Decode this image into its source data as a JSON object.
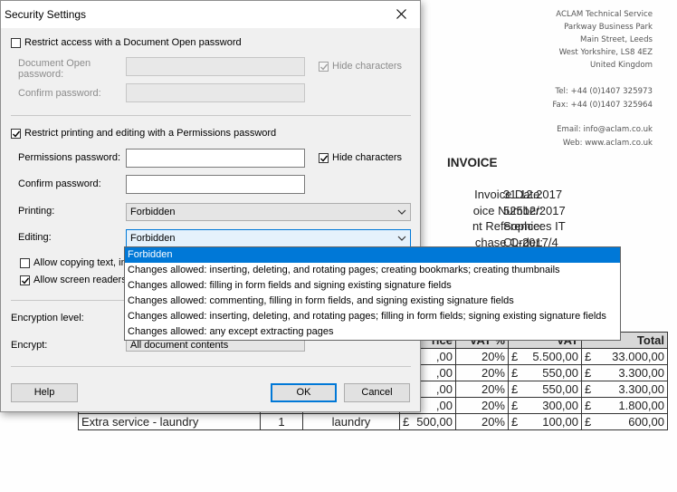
{
  "dialog": {
    "title": "Security Settings",
    "open_password": {
      "checkbox_label": "Restrict access with a Document Open password",
      "checked": false,
      "doc_open_label_line1": "Document Open",
      "doc_open_label_line2": "password:",
      "confirm_label": "Confirm password:",
      "hide_label": "Hide characters",
      "hide_checked": true
    },
    "permissions": {
      "checkbox_label": "Restrict printing and editing with a Permissions password",
      "checked": true,
      "password_label": "Permissions password:",
      "confirm_label": "Confirm password:",
      "hide_label": "Hide characters",
      "hide_checked": true,
      "printing_label": "Printing:",
      "printing_value": "Forbidden",
      "editing_label": "Editing:",
      "editing_value": "Forbidden",
      "allow_copy_label": "Allow copying text, im",
      "allow_copy_checked": false,
      "allow_screen_label": "Allow screen readers",
      "allow_screen_checked": true
    },
    "encryption": {
      "level_label": "Encryption level:",
      "encrypt_label": "Encrypt:",
      "encrypt_value": "All document contents"
    },
    "buttons": {
      "help": "Help",
      "ok": "OK",
      "cancel": "Cancel"
    },
    "editing_options": [
      "Forbidden",
      "Changes allowed: inserting, deleting, and rotating pages; creating bookmarks; creating thumbnails",
      "Changes allowed: filling in form fields and signing existing signature fields",
      "Changes allowed: commenting, filling in form fields, and signing existing signature fields",
      "Changes allowed: inserting, deleting, and rotating pages; filling in form fields; signing existing signature fields",
      "Changes allowed: any except extracting pages"
    ],
    "editing_selected_index": 0
  },
  "invoice": {
    "company_lines": [
      "ACLAM Technical Service",
      "Parkway Business Park",
      "Main Street, Leeds",
      "West Yorkshire, LS8 4EZ",
      "United Kingdom"
    ],
    "tel": "Tel: +44 (0)1407 325973",
    "fax": "Fax: +44 (0)1407 325964",
    "email": "Email: info@aclam.co.uk",
    "web": "Web: www.aclam.co.uk",
    "title": "INVOICE",
    "meta": [
      {
        "label": "Invoice Date:",
        "value": "31.12.2017"
      },
      {
        "label": "oice Number:",
        "value": "52512/2017"
      },
      {
        "label": "nt Reference:",
        "value": "Sophices IT"
      },
      {
        "label": "chase Order:",
        "value": "CL-2017/4"
      }
    ],
    "table_header": {
      "price": "rice",
      "vat": "VAT %",
      "vat_amount": "VAT",
      "total": "Total"
    },
    "rows": [
      {
        "desc": "",
        "qty": "",
        "unit": "",
        "price": ",00",
        "vat": "20%",
        "vat_cur": "£",
        "vat_amount": "5.500,00",
        "total_cur": "£",
        "total": "33.000,00"
      },
      {
        "desc": "",
        "qty": "",
        "unit": "",
        "price": ",00",
        "vat": "20%",
        "vat_cur": "£",
        "vat_amount": "550,00",
        "total_cur": "£",
        "total": "3.300,00"
      },
      {
        "desc": "",
        "qty": "",
        "unit": "",
        "price": ",00",
        "vat": "20%",
        "vat_cur": "£",
        "vat_amount": "550,00",
        "total_cur": "£",
        "total": "3.300,00"
      },
      {
        "desc": "",
        "qty": "",
        "unit": "",
        "price": ",00",
        "vat": "20%",
        "vat_cur": "£",
        "vat_amount": "300,00",
        "total_cur": "£",
        "total": "1.800,00"
      },
      {
        "desc": "Extra service - laundry",
        "qty": "1",
        "unit": "laundry",
        "price_cur": "£",
        "price": "500,00",
        "vat": "20%",
        "vat_cur": "£",
        "vat_amount": "100,00",
        "total_cur": "£",
        "total": "600,00"
      }
    ]
  },
  "colors": {
    "accent": "#0078d7",
    "dialog_bg": "#f0f0f0"
  }
}
